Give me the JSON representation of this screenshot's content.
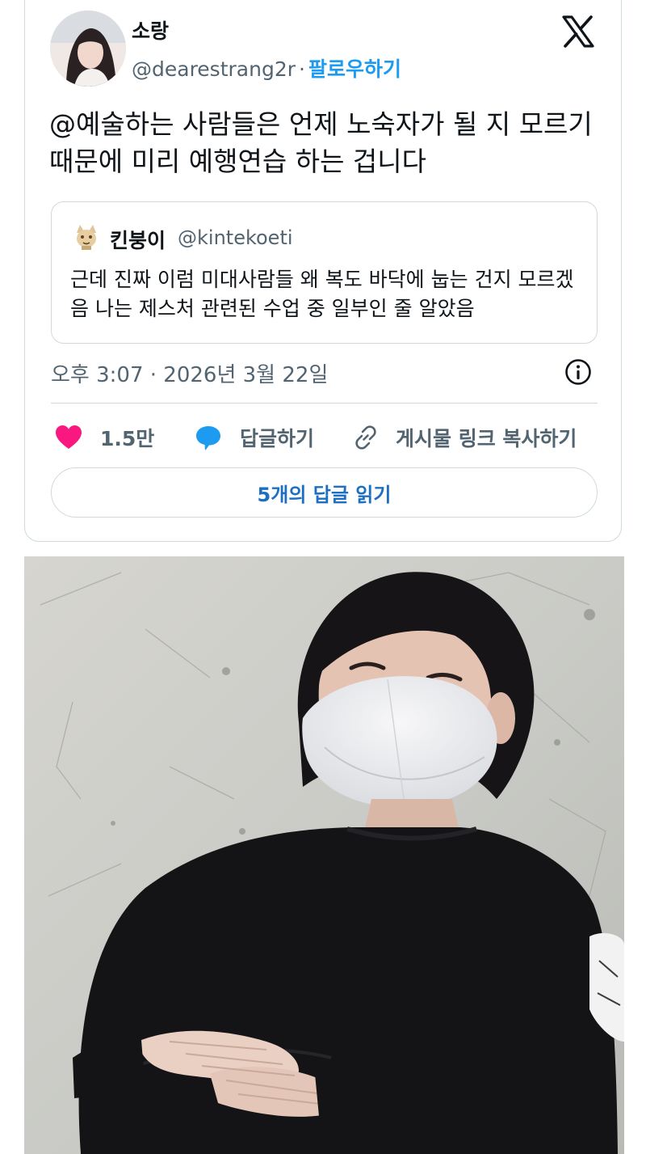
{
  "tweet": {
    "author": {
      "display_name": "소랑",
      "handle": "@dearestrang2r",
      "separator": "·",
      "follow_label": "팔로우하기"
    },
    "platform_icon": "x-logo-icon",
    "text": "@예술하는 사람들은 언제 노숙자가 될 지 모르기 때문에 미리 예행연습 하는 겁니다",
    "quote": {
      "display_name": "킨붕이",
      "handle": "@kintekoeti",
      "text": "근데 진짜 이럼 미대사람들 왜 복도 바닥에 눕는 건지 모르겠음 나는 제스처 관련된 수업 중 일부인 줄 알았음"
    },
    "timestamp": "오후 3:07 · 2026년 3월 22일",
    "info_icon": "info-icon",
    "actions": {
      "like_count": "1.5만",
      "reply_label": "답글하기",
      "copy_link_label": "게시물 링크 복사하기"
    },
    "read_replies_label": "5개의 답글 읽기"
  },
  "colors": {
    "accent": "#1d9bf0",
    "like": "#f91880",
    "secondary_text": "#536471",
    "border": "#cfd9de"
  }
}
